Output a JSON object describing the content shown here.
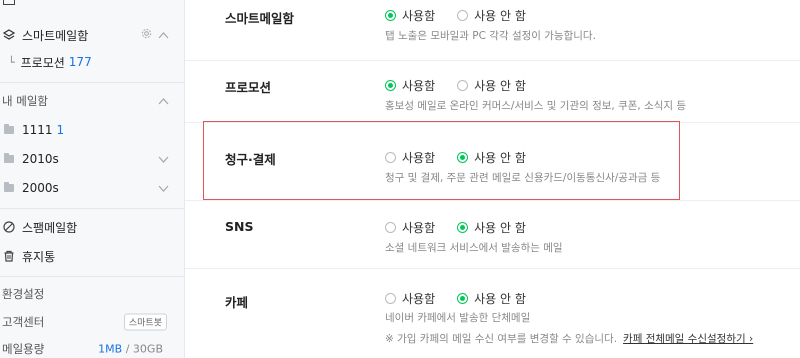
{
  "sidebar": {
    "smart_mailbox": "스마트메일함",
    "promotion": {
      "label": "프로모션",
      "count": "177"
    },
    "my_mailbox_header": "내 메일함",
    "folders": [
      {
        "name": "1111",
        "count": "1"
      },
      {
        "name": "2010s"
      },
      {
        "name": "2000s"
      }
    ],
    "spam": "스팸메일함",
    "trash": "휴지통",
    "settings": "환경설정",
    "support": "고객센터",
    "support_badge": "스마트봇",
    "storage_label": "메일용량",
    "storage_used": "1MB",
    "storage_sep": " / ",
    "storage_total": "30GB"
  },
  "options": {
    "use": "사용함",
    "no_use": "사용 안 함"
  },
  "settings": [
    {
      "title": "스마트메일함",
      "selected": "use",
      "desc": "탭 노출은 모바일과 PC 각각 설정이 가능합니다."
    },
    {
      "title": "프로모션",
      "selected": "use",
      "desc": "홍보성 메일로 온라인 커머스/서비스 및 기관의 정보, 쿠폰, 소식지 등"
    },
    {
      "title": "청구·결제",
      "selected": "no_use",
      "desc": "청구 및 결제, 주문 관련 메일로 신용카드/이동통신사/공과금 등"
    },
    {
      "title": "SNS",
      "selected": "no_use",
      "desc": "소셜 네트워크 서비스에서 발송하는 메일"
    },
    {
      "title": "카페",
      "selected": "no_use",
      "desc": "네이버 카페에서 발송한 단체메일",
      "note": "※ 가입 카페의 메일 수신 여부를 변경할 수 있습니다.",
      "note_link": "카페 전체메일 수신설정하기 ›"
    }
  ],
  "colors": {
    "accent_green": "#03c75a",
    "link_blue": "#1a73e8",
    "highlight_red": "#e05656"
  }
}
